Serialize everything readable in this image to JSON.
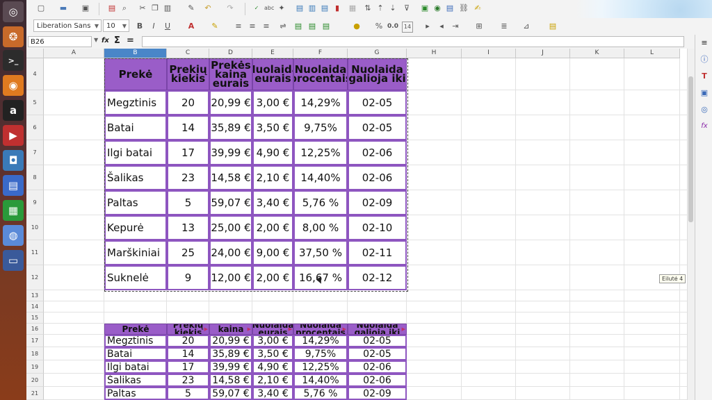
{
  "toolbar": {
    "font_name": "Liberation Sans",
    "font_size": "10",
    "number_format": "0.0",
    "decimal_count": "14"
  },
  "formula_bar": {
    "cell_ref": "B26",
    "fx": "fx",
    "sum": "Σ",
    "equals": "="
  },
  "columns": [
    "A",
    "B",
    "C",
    "D",
    "E",
    "F",
    "G",
    "H",
    "I",
    "J",
    "K",
    "L"
  ],
  "rows_labels": [
    "4",
    "5",
    "6",
    "7",
    "8",
    "9",
    "10",
    "11",
    "12",
    "13",
    "14",
    "15",
    "16",
    "17",
    "18",
    "19",
    "20",
    "21"
  ],
  "table1": {
    "headers": [
      "Prekė",
      "Prekių kiekis",
      "Prekės kaina eurais",
      "Nuolaida eurais",
      "Nuolaida procentais",
      "Nuolaida galioja iki"
    ],
    "rows": [
      [
        "Megztinis",
        "20",
        "20,99 €",
        "3,00 €",
        "14,29%",
        "02-05"
      ],
      [
        "Batai",
        "14",
        "35,89 €",
        "3,50 €",
        "9,75%",
        "02-05"
      ],
      [
        "Ilgi batai",
        "17",
        "39,99 €",
        "4,90 €",
        "12,25%",
        "02-06"
      ],
      [
        "Šalikas",
        "23",
        "14,58 €",
        "2,10 €",
        "14,40%",
        "02-06"
      ],
      [
        "Paltas",
        "5",
        "59,07 €",
        "3,40 €",
        "5,76 %",
        "02-09"
      ],
      [
        "Kepurė",
        "13",
        "25,00 €",
        "2,00 €",
        "8,00 %",
        "02-10"
      ],
      [
        "Marškiniai",
        "25",
        "24,00 €",
        "9,00 €",
        "37,50 %",
        "02-11"
      ],
      [
        "Suknelė",
        "9",
        "12,00 €",
        "2,00 €",
        "16,67 %",
        "02-12"
      ]
    ]
  },
  "table2": {
    "headers": [
      "Prekė",
      "Prekių kiekis",
      "kaina",
      "Nuolaida eurais",
      "Nuolaida procentais",
      "Nuolaida galioja iki"
    ],
    "rows": [
      [
        "Megztinis",
        "20",
        "20,99 €",
        "3,00 €",
        "14,29%",
        "02-05"
      ],
      [
        "Batai",
        "14",
        "35,89 €",
        "3,50 €",
        "9,75%",
        "02-05"
      ],
      [
        "Ilgi batai",
        "17",
        "39,99 €",
        "4,90 €",
        "12,25%",
        "02-06"
      ],
      [
        "Šalikas",
        "23",
        "14,58 €",
        "2,10 €",
        "14,40%",
        "02-06"
      ],
      [
        "Paltas",
        "5",
        "59,07 €",
        "3,40 €",
        "5,76 %",
        "02-09"
      ]
    ]
  },
  "tooltip": "Eilutė 4",
  "colors": {
    "header_purple": "#9a5dc8",
    "border_purple": "#8e56c0",
    "selected_col": "#4a86c8"
  }
}
